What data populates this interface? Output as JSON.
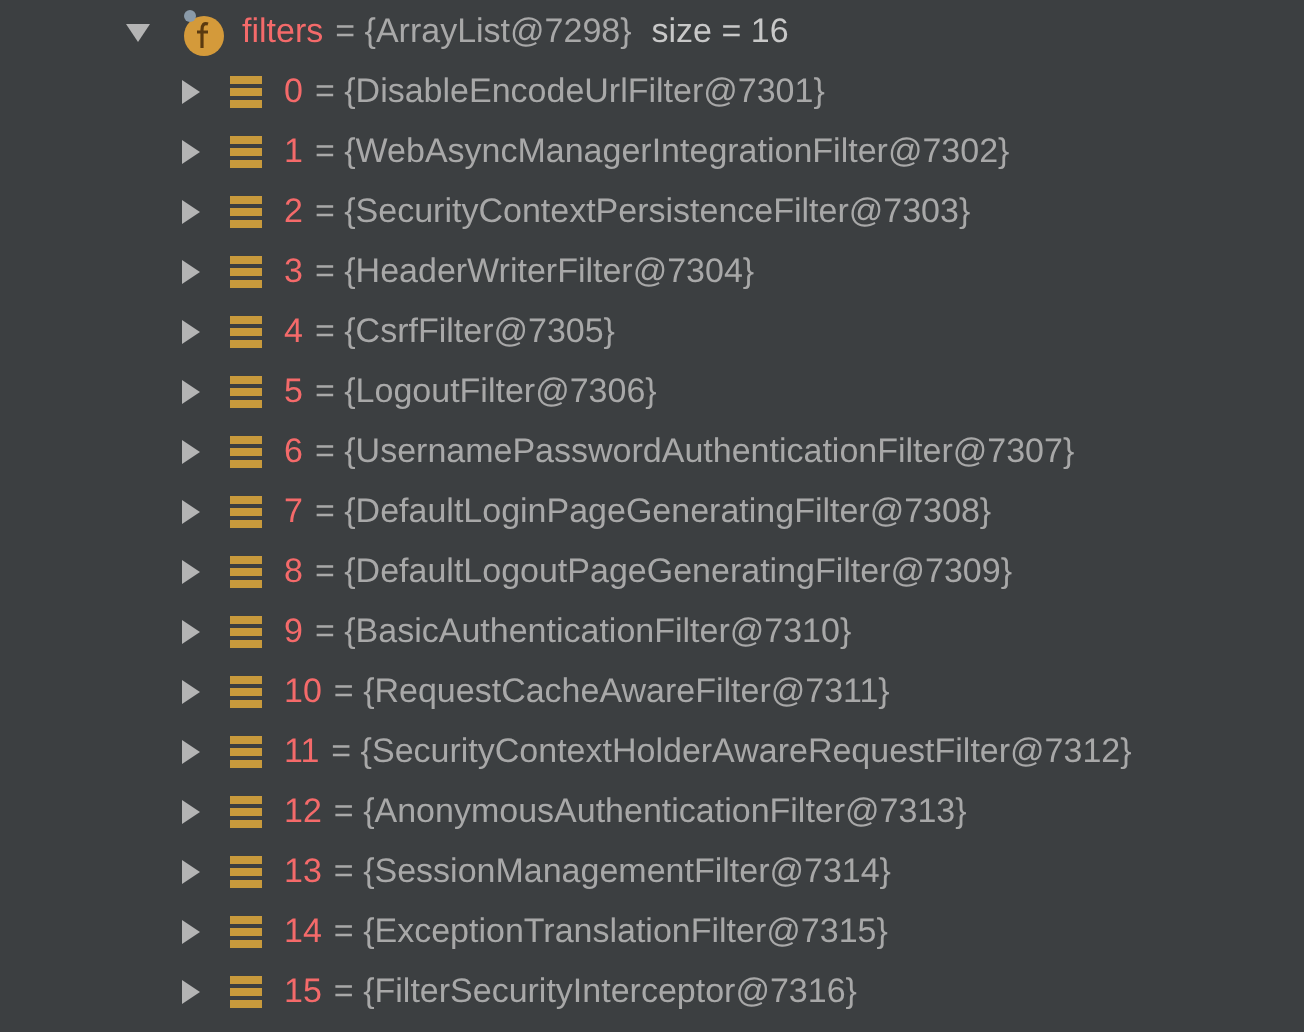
{
  "root": {
    "name": "filters",
    "value": "= {ArrayList@7298}",
    "extra": "size = 16",
    "expanded": true,
    "children": [
      {
        "name": "0",
        "value": "= {DisableEncodeUrlFilter@7301}",
        "expanded": false
      },
      {
        "name": "1",
        "value": "= {WebAsyncManagerIntegrationFilter@7302}",
        "expanded": false
      },
      {
        "name": "2",
        "value": "= {SecurityContextPersistenceFilter@7303}",
        "expanded": false
      },
      {
        "name": "3",
        "value": "= {HeaderWriterFilter@7304}",
        "expanded": false
      },
      {
        "name": "4",
        "value": "= {CsrfFilter@7305}",
        "expanded": false
      },
      {
        "name": "5",
        "value": "= {LogoutFilter@7306}",
        "expanded": false
      },
      {
        "name": "6",
        "value": "= {UsernamePasswordAuthenticationFilter@7307}",
        "expanded": false
      },
      {
        "name": "7",
        "value": "= {DefaultLoginPageGeneratingFilter@7308}",
        "expanded": false
      },
      {
        "name": "8",
        "value": "= {DefaultLogoutPageGeneratingFilter@7309}",
        "expanded": false
      },
      {
        "name": "9",
        "value": "= {BasicAuthenticationFilter@7310}",
        "expanded": false
      },
      {
        "name": "10",
        "value": "= {RequestCacheAwareFilter@7311}",
        "expanded": false
      },
      {
        "name": "11",
        "value": "= {SecurityContextHolderAwareRequestFilter@7312}",
        "expanded": false
      },
      {
        "name": "12",
        "value": "= {AnonymousAuthenticationFilter@7313}",
        "expanded": false
      },
      {
        "name": "13",
        "value": "= {SessionManagementFilter@7314}",
        "expanded": false
      },
      {
        "name": "14",
        "value": "= {ExceptionTranslationFilter@7315}",
        "expanded": false
      },
      {
        "name": "15",
        "value": "= {FilterSecurityInterceptor@7316}",
        "expanded": false
      }
    ]
  }
}
